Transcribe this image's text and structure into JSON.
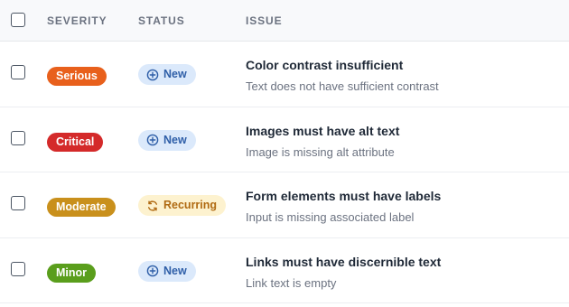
{
  "header": {
    "severity": "SEVERITY",
    "status": "STATUS",
    "issue": "ISSUE"
  },
  "rows": [
    {
      "severity": "Serious",
      "severity_color": "#e8601c",
      "status": "New",
      "status_icon": "plus-circle-icon",
      "status_bg": "#dbe9fb",
      "status_fg": "#2f5fa8",
      "title": "Color contrast insufficient",
      "description": "Text does not have sufficient contrast"
    },
    {
      "severity": "Critical",
      "severity_color": "#d42a2a",
      "status": "New",
      "status_icon": "plus-circle-icon",
      "status_bg": "#dbe9fb",
      "status_fg": "#2f5fa8",
      "title": "Images must have alt text",
      "description": "Image is missing alt attribute"
    },
    {
      "severity": "Moderate",
      "severity_color": "#c9901c",
      "status": "Recurring",
      "status_icon": "refresh-icon",
      "status_bg": "#fdf2cf",
      "status_fg": "#b06a12",
      "title": "Form elements must have labels",
      "description": "Input is missing associated label"
    },
    {
      "severity": "Minor",
      "severity_color": "#5a9e1c",
      "status": "New",
      "status_icon": "plus-circle-icon",
      "status_bg": "#dbe9fb",
      "status_fg": "#2f5fa8",
      "title": "Links must have discernible text",
      "description": "Link text is empty"
    }
  ]
}
